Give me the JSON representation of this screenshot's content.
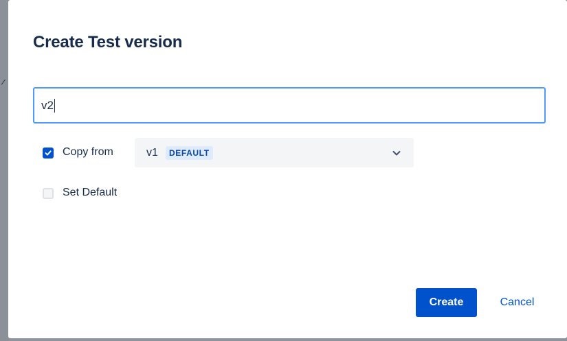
{
  "dialog": {
    "title": "Create Test version",
    "name_input": {
      "value": "v2"
    },
    "copy_from": {
      "checked": true,
      "label": "Copy from",
      "selected_version": "v1",
      "selected_badge": "DEFAULT"
    },
    "set_default": {
      "checked": false,
      "label": "Set Default"
    },
    "buttons": {
      "create": "Create",
      "cancel": "Cancel"
    }
  },
  "colors": {
    "primary": "#0052cc",
    "input_focus_border": "#4c9aff",
    "text": "#172b4d",
    "badge_bg": "#deebff",
    "overlay": "#8f939c"
  },
  "icons": {
    "checkbox_checked": "check-icon",
    "select_arrow": "chevron-down-icon"
  }
}
